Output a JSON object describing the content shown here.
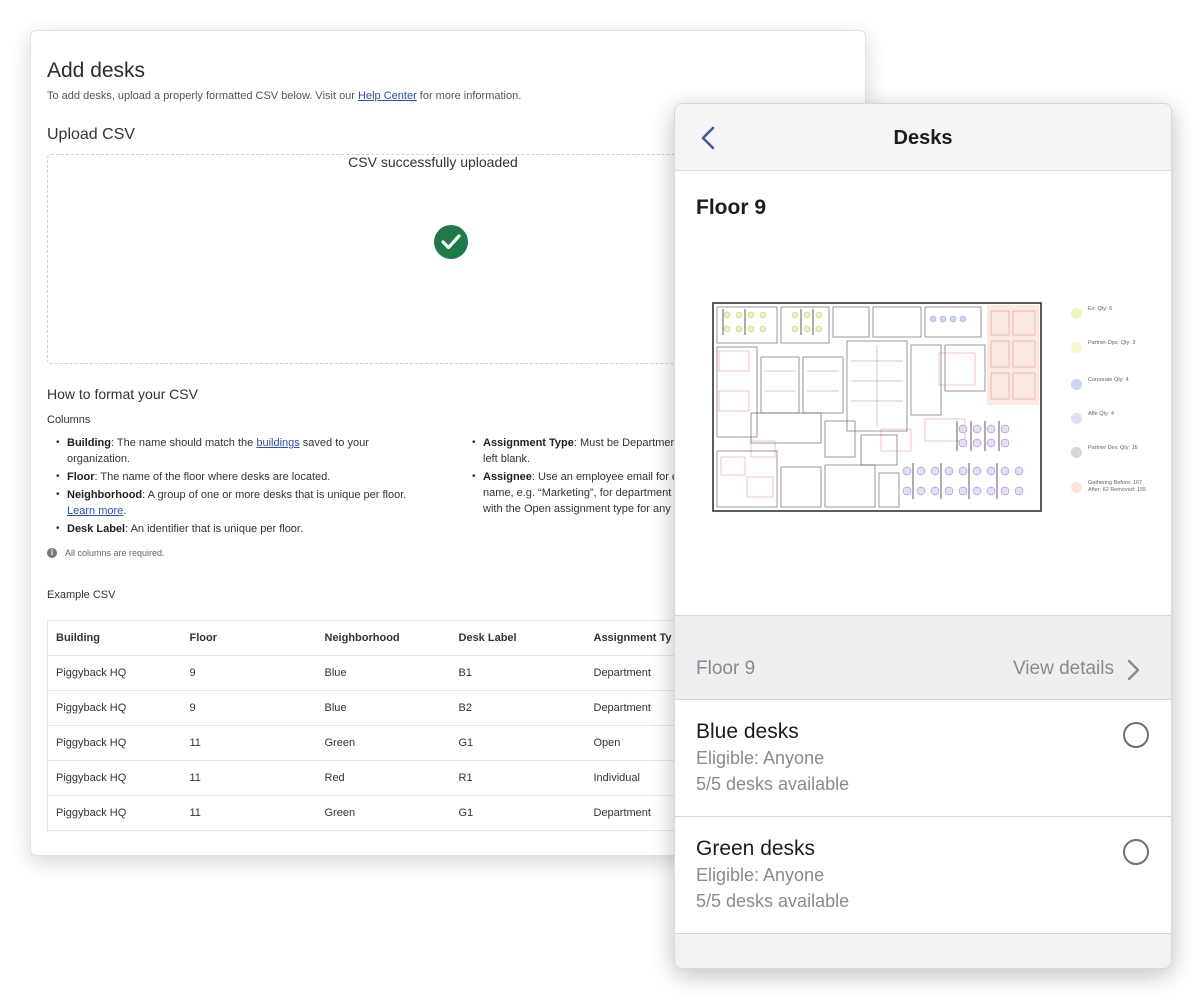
{
  "web": {
    "title": "Add desks",
    "intro_before": "To add desks, upload a properly formatted CSV below. Visit our ",
    "intro_link": "Help Center",
    "intro_after": " for more information.",
    "upload_title": "Upload CSV",
    "upload_status": "CSV successfully uploaded",
    "format_title": "How to format your CSV",
    "columns_label": "Columns",
    "columns_left": [
      {
        "name": "Building",
        "desc_before": ": The name should match the ",
        "link": "buildings",
        "desc_after": " saved to your organization."
      },
      {
        "name": "Floor",
        "desc": ": The name of the floor where desks are located."
      },
      {
        "name": "Neighborhood",
        "desc": ": A group of one or more desks that is unique per floor. ",
        "link": "Learn more",
        "desc_after": "."
      },
      {
        "name": "Desk Label",
        "desc": ": An identifier that is unique per floor."
      }
    ],
    "columns_right": [
      {
        "name": "Assignment Type",
        "desc": ": Must be Departmen",
        "desc2": "left blank."
      },
      {
        "name": "Assignee",
        "desc": ": Use an employee email for e",
        "desc2": "name, e.g. “Marketing”, for department",
        "desc3": "with the Open assignment type for any"
      }
    ],
    "note": "All columns are required.",
    "example_label": "Example CSV",
    "table": {
      "headers": [
        "Building",
        "Floor",
        "Neighborhood",
        "Desk Label",
        "Assignment Ty"
      ],
      "rows": [
        [
          "Piggyback HQ",
          "9",
          "Blue",
          "B1",
          "Department"
        ],
        [
          "Piggyback HQ",
          "9",
          "Blue",
          "B2",
          "Department"
        ],
        [
          "Piggyback HQ",
          "11",
          "Green",
          "G1",
          "Open"
        ],
        [
          "Piggyback HQ",
          "11",
          "Red",
          "R1",
          "Individual"
        ],
        [
          "Piggyback HQ",
          "11",
          "Green",
          "G1",
          "Department"
        ]
      ]
    },
    "colors": {
      "link": "#2b4fb3",
      "success": "#1e7a46"
    }
  },
  "mobile": {
    "nav_title": "Desks",
    "floor_title": "Floor 9",
    "legend": [
      {
        "label": "Ex. Qty: 6",
        "color": "#eef5b8"
      },
      {
        "label": "Partner Ops. Qty: 3",
        "color": "#f7f7c8"
      },
      {
        "label": "Corporate Qty: 4",
        "color": "#c9d8f5"
      },
      {
        "label": "Affe Qty: 4",
        "color": "#e6dcf7"
      },
      {
        "label": "Partner Dev. Qty: 15",
        "color": "#d9d4dc"
      },
      {
        "label": "Gathering Before: 167 After: 62 Removed: 155",
        "color": "#fbe4dc"
      }
    ],
    "detail": {
      "floor": "Floor 9",
      "action": "View details"
    },
    "desks": [
      {
        "name": "Blue desks",
        "eligible": "Eligible: Anyone",
        "available": "5/5 desks available"
      },
      {
        "name": "Green desks",
        "eligible": "Eligible: Anyone",
        "available": "5/5 desks available"
      }
    ]
  }
}
